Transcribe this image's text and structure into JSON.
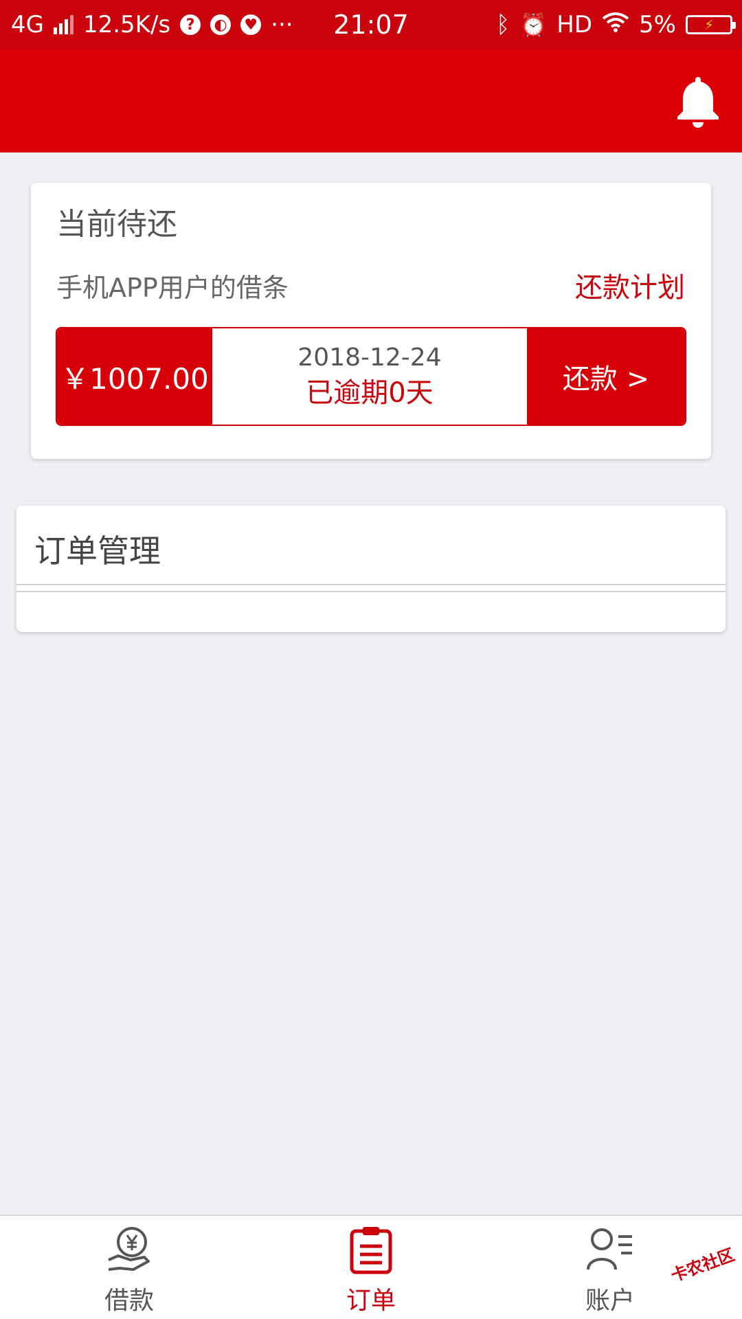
{
  "status_bar": {
    "network": "4G",
    "speed": "12.5K/s",
    "time": "21:07",
    "hd": "HD",
    "battery": "5%",
    "more": "···"
  },
  "header": {
    "icon": "bell-icon",
    "background": "#db0008"
  },
  "pending": {
    "title": "当前待还",
    "loan_name": "手机APP用户的借条",
    "plan_link": "还款计划",
    "amount": "￥1007.00",
    "due_date": "2018-12-24",
    "overdue_text": "已逾期0天",
    "repay_button": "还款 >"
  },
  "orders": {
    "title": "订单管理"
  },
  "tabbar": {
    "items": [
      {
        "label": "借款",
        "icon": "yen-hand-icon",
        "active": false
      },
      {
        "label": "订单",
        "icon": "clipboard-icon",
        "active": true
      },
      {
        "label": "账户",
        "icon": "user-list-icon",
        "active": false
      }
    ]
  },
  "watermark": "卡农社区",
  "colors": {
    "accent": "#c9020c",
    "background": "#f0eff3"
  }
}
